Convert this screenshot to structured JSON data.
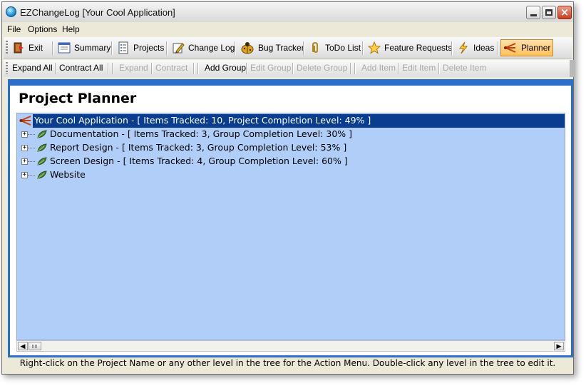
{
  "window": {
    "title": "EZChangeLog [Your Cool Application]"
  },
  "menu": [
    "File",
    "Options",
    "Help"
  ],
  "toolbar": {
    "exit": "Exit",
    "summary": "Summary",
    "projects": "Projects",
    "change_log": "Change Log",
    "bug_tracker": "Bug Tracker",
    "todo_list": "ToDo List",
    "feature_requests": "Feature Requests",
    "ideas": "Ideas",
    "planner": "Planner"
  },
  "toolbar2": {
    "expand_all": "Expand All",
    "contract_all": "Contract All",
    "expand": "Expand",
    "contract": "Contract",
    "add_group": "Add Group",
    "edit_group": "Edit Group",
    "delete_group": "Delete Group",
    "add_item": "Add Item",
    "edit_item": "Edit Item",
    "delete_item": "Delete Item"
  },
  "planner": {
    "title": "Project Planner",
    "root": "Your Cool Application - [ Items Tracked: 10, Project Completion Level: 49% ]",
    "groups": [
      "Documentation - [ Items Tracked: 3, Group Completion Level: 30% ]",
      "Report Design - [ Items Tracked: 3, Group Completion Level: 53% ]",
      "Screen Design - [ Items Tracked: 4, Group Completion Level: 60% ]",
      "Website"
    ]
  },
  "status": "Right-click on the Project Name or any other level in the tree for the Action Menu.  Double-click any level in the tree to edit it.",
  "colors": {
    "selection": "#0a3d8f",
    "tree_background": "#b0cef8",
    "active_tab": "#ffc25a",
    "frame_blue": "#2a6fc9"
  }
}
